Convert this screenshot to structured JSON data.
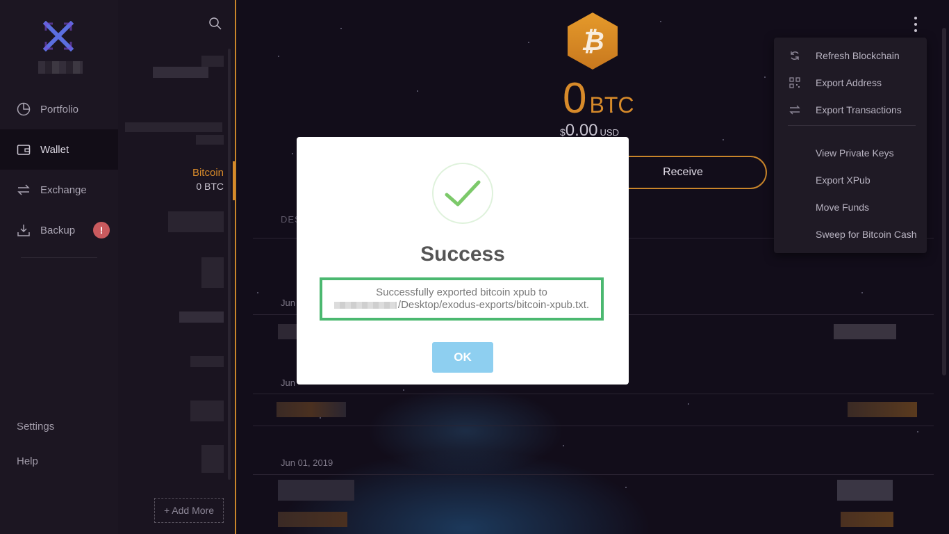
{
  "nav": {
    "items": [
      {
        "label": "Portfolio",
        "icon": "pie-chart-icon"
      },
      {
        "label": "Wallet",
        "icon": "wallet-icon"
      },
      {
        "label": "Exchange",
        "icon": "exchange-arrows-icon"
      },
      {
        "label": "Backup",
        "icon": "download-tray-icon",
        "badge": "!"
      }
    ],
    "settings": "Settings",
    "help": "Help"
  },
  "assets": {
    "selected_name": "Bitcoin",
    "selected_balance": "0 BTC",
    "add_more": "+ Add More"
  },
  "wallet": {
    "amount": "0",
    "unit": "BTC",
    "usd_symbol": "$",
    "usd_value": "0.00",
    "usd_currency": "USD",
    "receive": "Receive",
    "col_head": "DES",
    "dates": [
      "Jun",
      "Jun",
      "Jun 01, 2019"
    ]
  },
  "menu": {
    "items": [
      "Refresh Blockchain",
      "Export Address",
      "Export Transactions",
      "View Private Keys",
      "Export XPub",
      "Move Funds",
      "Sweep for Bitcoin Cash"
    ]
  },
  "modal": {
    "title": "Success",
    "message_line1": "Successfully exported bitcoin xpub to",
    "message_line2": "/Desktop/exodus-exports/bitcoin-xpub.txt.",
    "ok": "OK"
  },
  "colors": {
    "accent": "#d78a2a",
    "success_border": "#4bb870",
    "ok_button": "#8ecff0",
    "badge": "#c95a5e"
  }
}
